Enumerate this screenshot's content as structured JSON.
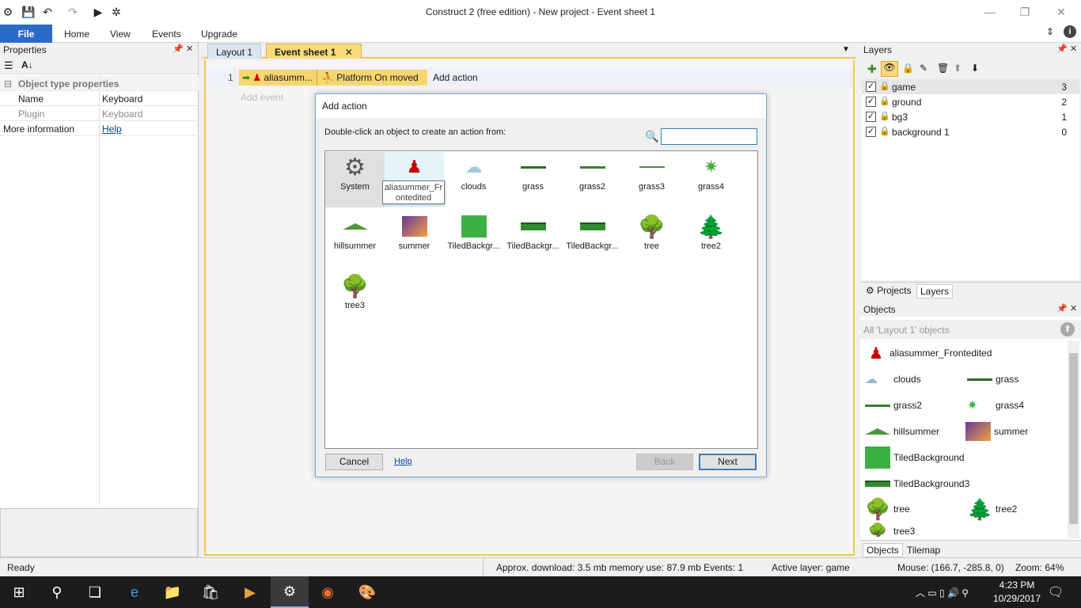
{
  "window": {
    "title": "Construct 2  (free edition) - New project - Event sheet 1"
  },
  "ribbon": {
    "file": "File",
    "tabs": [
      "Home",
      "View",
      "Events",
      "Upgrade"
    ]
  },
  "properties": {
    "title": "Properties",
    "section": "Object type properties",
    "rows": [
      {
        "name": "Name",
        "value": "Keyboard"
      },
      {
        "name": "Plugin",
        "value": "Keyboard"
      }
    ],
    "more_info": "More information",
    "help": "Help"
  },
  "tabs": {
    "layout": "Layout 1",
    "event_sheet": "Event sheet 1"
  },
  "event": {
    "number": "1",
    "object": "aliasumm...",
    "condition": "Platform On moved",
    "add_action": "Add action",
    "add_event": "Add event"
  },
  "dialog": {
    "title": "Add action",
    "instruction": "Double-click an object to create an action from:",
    "search_value": "",
    "items": [
      {
        "label": "System",
        "icon": "gear-icon"
      },
      {
        "label": "aliasummer_Frontedited",
        "icon": "character-icon"
      },
      {
        "label": "clouds",
        "icon": "cloud-icon"
      },
      {
        "label": "grass",
        "icon": "grass-strip-icon"
      },
      {
        "label": "grass2",
        "icon": "grass-strip-icon"
      },
      {
        "label": "grass3",
        "icon": "grass-strip-icon"
      },
      {
        "label": "grass4",
        "icon": "grass-tuft-icon"
      },
      {
        "label": "hillsummer",
        "icon": "hill-icon"
      },
      {
        "label": "summer",
        "icon": "sunset-icon"
      },
      {
        "label": "TiledBackgr...",
        "icon": "green-square-icon"
      },
      {
        "label": "TiledBackgr...",
        "icon": "tiled-grass-icon"
      },
      {
        "label": "TiledBackgr...",
        "icon": "tiled-grass-icon"
      },
      {
        "label": "tree",
        "icon": "tree-icon"
      },
      {
        "label": "tree2",
        "icon": "pine-tree-icon"
      },
      {
        "label": "tree3",
        "icon": "tree-icon"
      }
    ],
    "tooltip_line1": "aliasummer_Fr",
    "tooltip_line2": "ontedited",
    "cancel": "Cancel",
    "help": "Help",
    "back": "Back",
    "next": "Next"
  },
  "layers": {
    "title": "Layers",
    "rows": [
      {
        "name": "game",
        "index": "3"
      },
      {
        "name": "ground",
        "index": "2"
      },
      {
        "name": "bg3",
        "index": "1"
      },
      {
        "name": "background 1",
        "index": "0"
      }
    ],
    "tab_projects": "Projects",
    "tab_layers": "Layers"
  },
  "objects": {
    "title": "Objects",
    "filter": "All 'Layout 1' objects",
    "items": [
      "aliasummer_Frontedited",
      "clouds",
      "grass",
      "grass2",
      "grass4",
      "hillsummer",
      "summer",
      "TiledBackground",
      "TiledBackground3",
      "tree",
      "tree2",
      "tree3"
    ],
    "tab_objects": "Objects",
    "tab_tilemap": "Tilemap"
  },
  "status": {
    "ready": "Ready",
    "download": "Approx. download: 3.5 mb  memory use: 87.9 mb  Events: 1",
    "active_layer": "Active layer: game",
    "mouse": "Mouse: (166.7, -285.8, 0)",
    "zoom": "Zoom: 64%"
  },
  "taskbar": {
    "time": "4:23 PM",
    "date": "10/29/2017"
  }
}
